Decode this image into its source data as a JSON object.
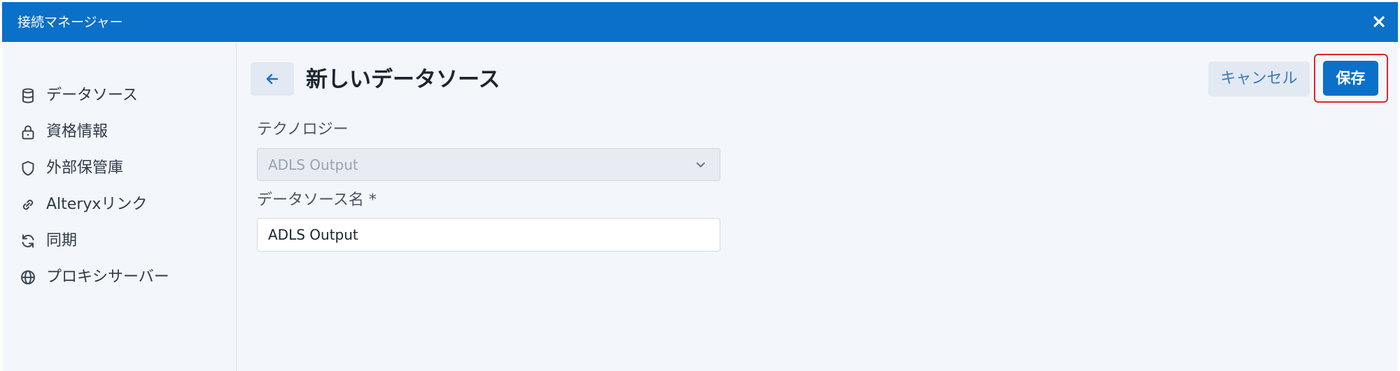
{
  "window": {
    "title": "接続マネージャー",
    "close_label": "×"
  },
  "sidebar": {
    "items": [
      {
        "label": "データソース",
        "icon": "database-icon"
      },
      {
        "label": "資格情報",
        "icon": "lock-icon"
      },
      {
        "label": "外部保管庫",
        "icon": "shield-icon"
      },
      {
        "label": "Alteryxリンク",
        "icon": "link-icon"
      },
      {
        "label": "同期",
        "icon": "sync-icon"
      },
      {
        "label": "プロキシサーバー",
        "icon": "globe-icon"
      }
    ]
  },
  "header": {
    "title": "新しいデータソース",
    "back_icon": "arrow-left-icon",
    "cancel_label": "キャンセル",
    "save_label": "保存"
  },
  "form": {
    "technology_label": "テクノロジー",
    "technology_value": "ADLS Output",
    "datasource_name_label": "データソース名 *",
    "datasource_name_value": "ADLS Output"
  },
  "colors": {
    "accent": "#0b70c7",
    "highlight": "#e0262b",
    "background": "#f3f6fb"
  }
}
